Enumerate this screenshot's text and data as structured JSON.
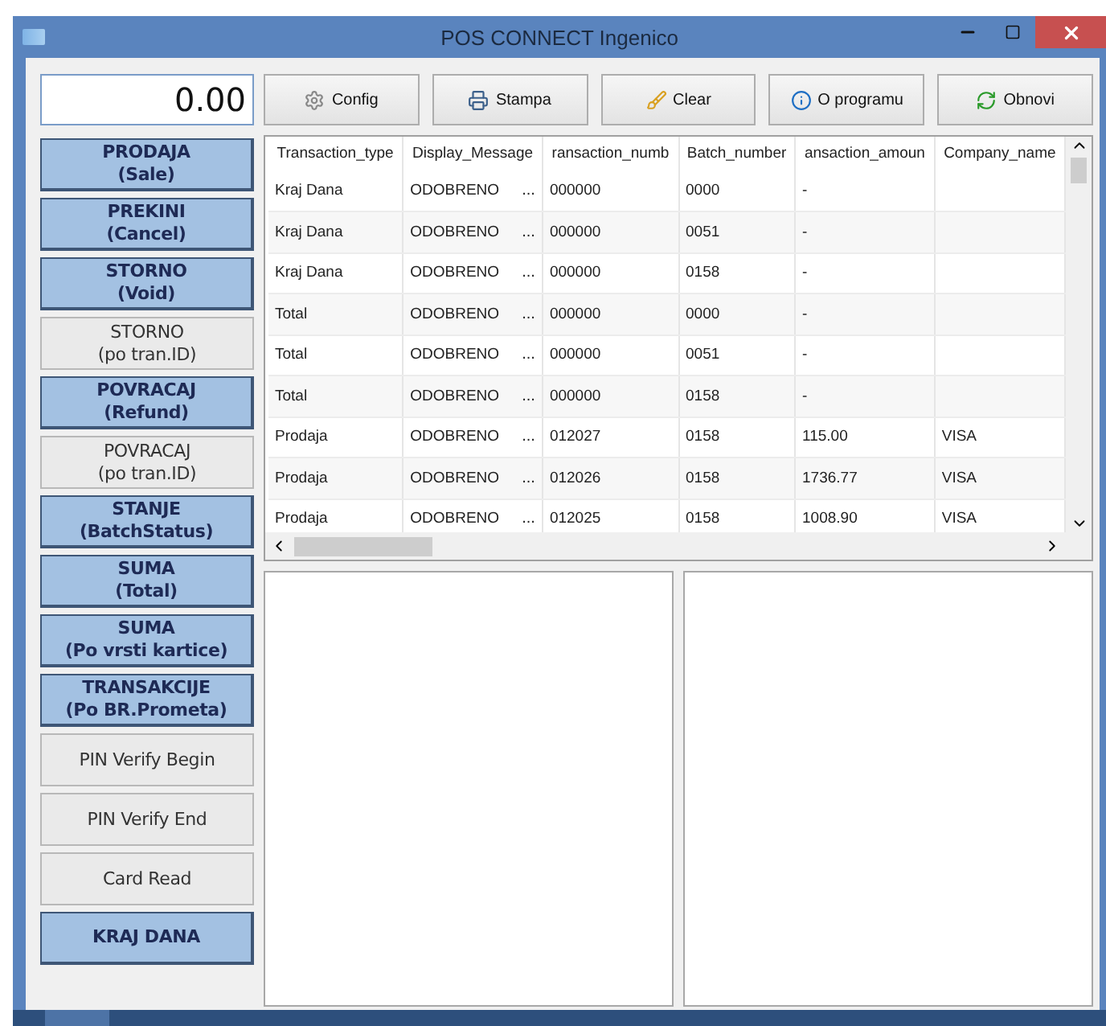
{
  "window": {
    "title": "POS CONNECT Ingenico"
  },
  "amount": {
    "value": "0.00"
  },
  "toolbar": [
    "Config",
    "Stampa",
    "Clear",
    "O programu",
    "Obnovi"
  ],
  "actions": [
    {
      "kind": "primary",
      "lines": [
        "PRODAJA",
        "(Sale)"
      ]
    },
    {
      "kind": "primary",
      "lines": [
        "PREKINI",
        "(Cancel)"
      ]
    },
    {
      "kind": "primary",
      "lines": [
        "STORNO",
        "(Void)"
      ]
    },
    {
      "kind": "plain",
      "lines": [
        "STORNO",
        "(po tran.ID)"
      ]
    },
    {
      "kind": "primary",
      "lines": [
        "POVRACAJ",
        "(Refund)"
      ]
    },
    {
      "kind": "plain",
      "lines": [
        "POVRACAJ",
        "(po tran.ID)"
      ]
    },
    {
      "kind": "primary",
      "lines": [
        "STANJE",
        "(BatchStatus)"
      ]
    },
    {
      "kind": "primary",
      "lines": [
        "SUMA",
        "(Total)"
      ]
    },
    {
      "kind": "primary",
      "lines": [
        "SUMA",
        "(Po vrsti kartice)"
      ]
    },
    {
      "kind": "primary",
      "lines": [
        "TRANSAKCIJE",
        "(Po BR.Prometa)"
      ]
    },
    {
      "kind": "plain",
      "lines": [
        "PIN Verify Begin"
      ]
    },
    {
      "kind": "plain",
      "lines": [
        "PIN Verify End"
      ]
    },
    {
      "kind": "plain",
      "lines": [
        "Card Read"
      ]
    },
    {
      "kind": "primary",
      "lines": [
        "KRAJ DANA"
      ]
    }
  ],
  "table": {
    "columns": [
      "Transaction_type",
      "Display_Message",
      "ransaction_numb",
      "Batch_number",
      "ansaction_amoun",
      "Company_name"
    ],
    "rows": [
      [
        "Kraj Dana",
        "ODOBRENO",
        "000000",
        "0000",
        "-",
        ""
      ],
      [
        "Kraj Dana",
        "ODOBRENO",
        "000000",
        "0051",
        "-",
        ""
      ],
      [
        "Kraj Dana",
        "ODOBRENO",
        "000000",
        "0158",
        "-",
        ""
      ],
      [
        "Total",
        "ODOBRENO",
        "000000",
        "0000",
        "-",
        ""
      ],
      [
        "Total",
        "ODOBRENO",
        "000000",
        "0051",
        "-",
        ""
      ],
      [
        "Total",
        "ODOBRENO",
        "000000",
        "0158",
        "-",
        ""
      ],
      [
        "Prodaja",
        "ODOBRENO",
        "012027",
        "0158",
        "115.00",
        "VISA"
      ],
      [
        "Prodaja",
        "ODOBRENO",
        "012026",
        "0158",
        "1736.77",
        "VISA"
      ],
      [
        "Prodaja",
        "ODOBRENO",
        "012025",
        "0158",
        "1008.90",
        "VISA"
      ]
    ],
    "cell_button": "..."
  }
}
